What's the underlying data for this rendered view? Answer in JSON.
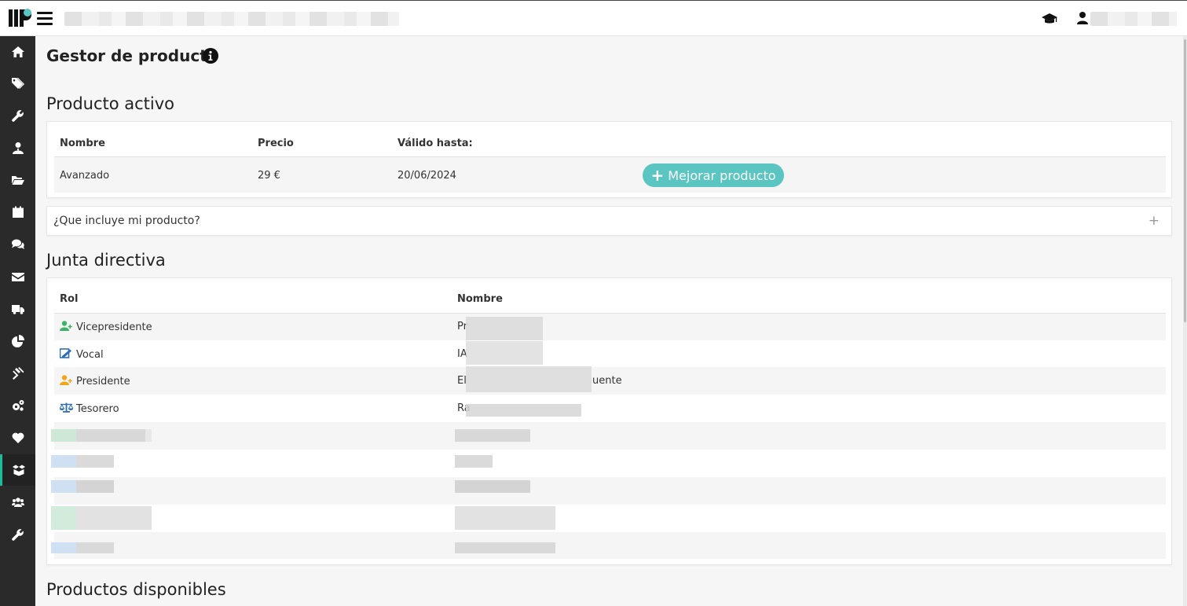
{
  "header": {
    "hamburger_label": "menu",
    "grad_icon": "graduation-cap-icon",
    "user_icon": "user-icon"
  },
  "sidebar": {
    "items": [
      {
        "icon": "home-icon"
      },
      {
        "icon": "tags-icon"
      },
      {
        "icon": "wrench-icon"
      },
      {
        "icon": "user-tie-icon"
      },
      {
        "icon": "folder-open-icon"
      },
      {
        "icon": "calendar-icon"
      },
      {
        "icon": "comments-icon"
      },
      {
        "icon": "envelope-icon"
      },
      {
        "icon": "truck-icon"
      },
      {
        "icon": "pie-chart-icon"
      },
      {
        "icon": "gavel-icon"
      },
      {
        "icon": "cogs-icon"
      },
      {
        "icon": "heart-icon"
      },
      {
        "icon": "box-open-icon",
        "active": true
      },
      {
        "icon": "users-icon"
      },
      {
        "icon": "wrench-icon"
      }
    ],
    "active_color": "#1abc9c"
  },
  "page": {
    "title": "Gestor de producto"
  },
  "producto_activo": {
    "title": "Producto activo",
    "columns": [
      "Nombre",
      "Precio",
      "Válido hasta:"
    ],
    "row": {
      "nombre": "Avanzado",
      "precio": "29 €",
      "valido": "20/06/2024"
    },
    "upgrade_button": "Mejorar producto",
    "accent": "#5bc5c1"
  },
  "accordion": {
    "label": "¿Que incluye mi producto?",
    "toggle": "+"
  },
  "junta": {
    "title": "Junta directiva",
    "columns": [
      "Rol",
      "Nombre"
    ],
    "rows": [
      {
        "rol": "Vicepresidente",
        "icon": "user-plus-icon",
        "color": "#3bb36a",
        "nombre": "Pr"
      },
      {
        "rol": "Vocal",
        "icon": "signature-icon",
        "color": "#2f6db5",
        "nombre": "IA"
      },
      {
        "rol": "Presidente",
        "icon": "user-plus-icon",
        "color": "#f0a51a",
        "nombre": "El",
        "nombre_suffix": "uente"
      },
      {
        "rol": "Tesorero",
        "icon": "balance-scale-icon",
        "color": "#2f6db5",
        "nombre": "Ra"
      }
    ]
  },
  "productos_disponibles": {
    "title": "Productos disponibles"
  }
}
